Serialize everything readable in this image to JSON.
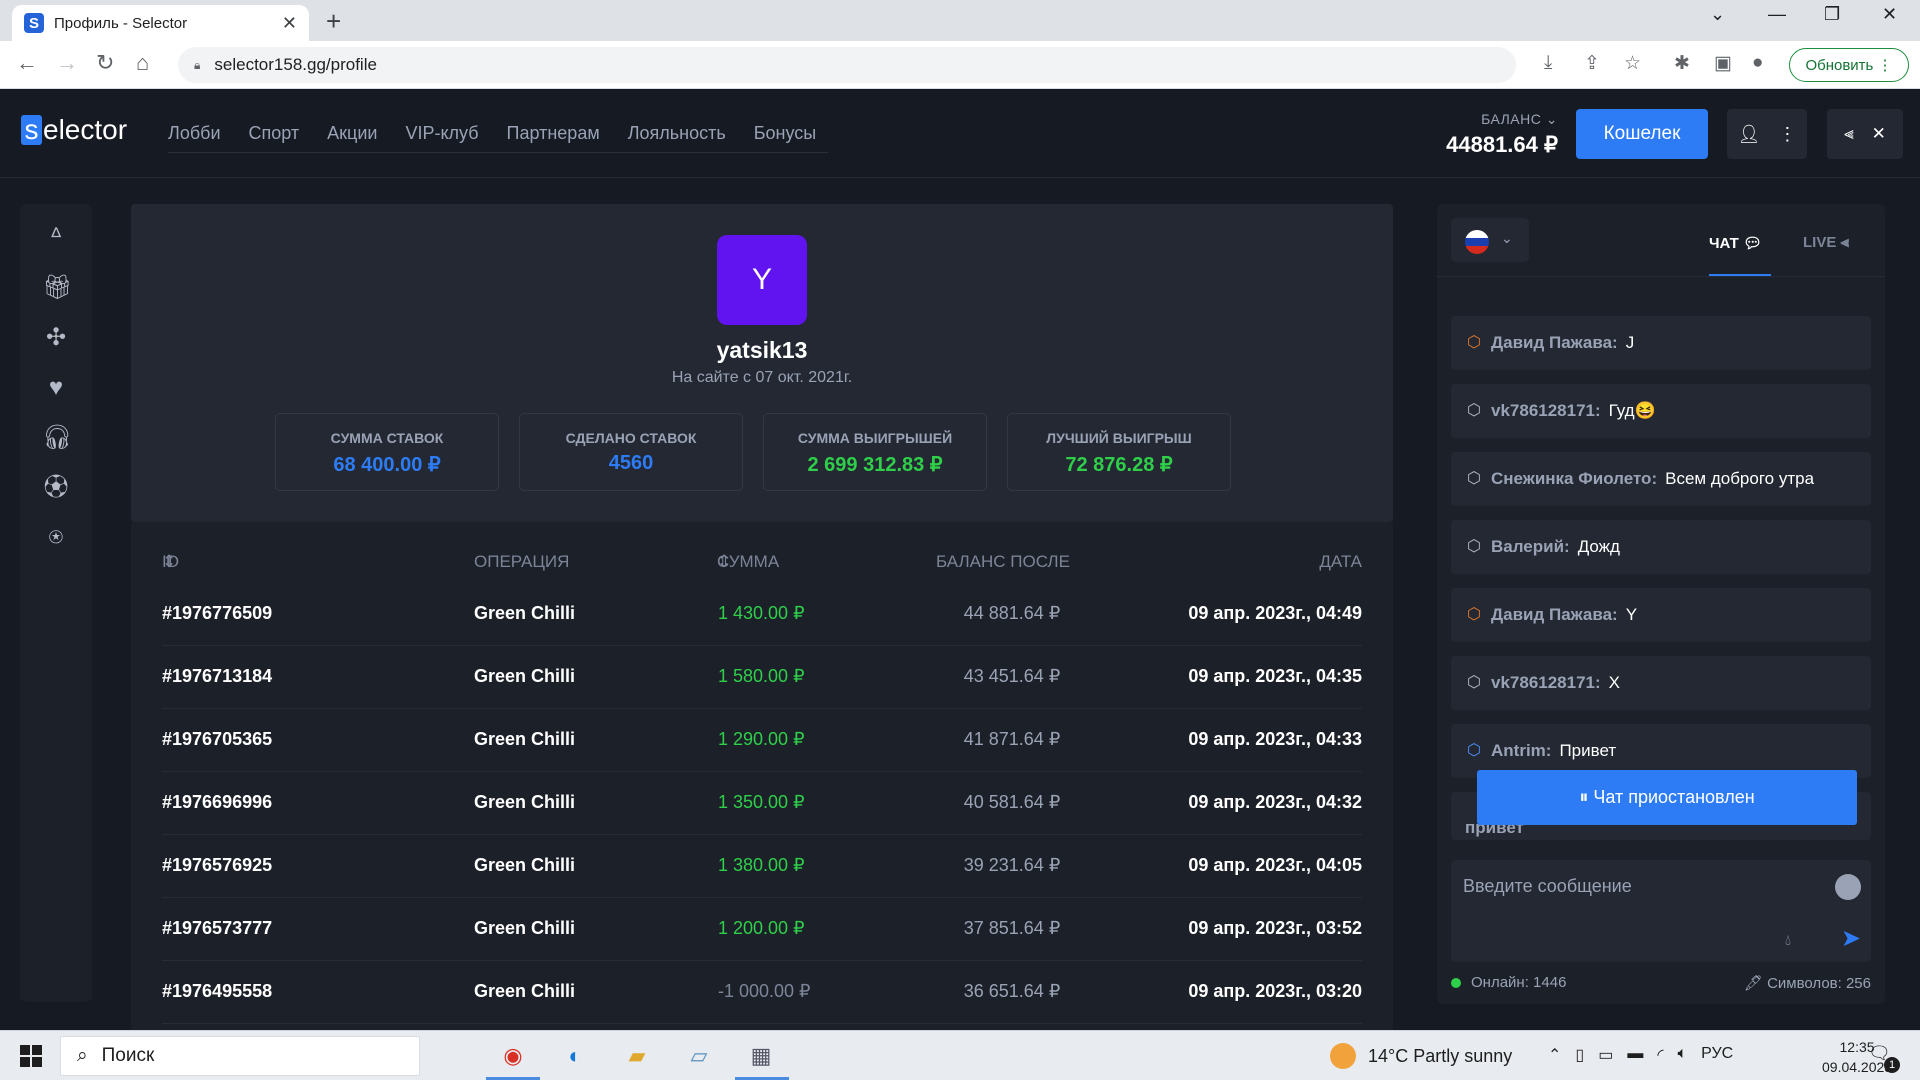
{
  "browser": {
    "tab_title": "Профиль - Selector",
    "tab_favicon": "S",
    "url": "selector158.gg/profile",
    "update_label": "Обновить"
  },
  "site": {
    "logo_first": "s",
    "logo_rest": "elector",
    "nav": [
      "Лобби",
      "Спорт",
      "Акции",
      "VIP-клуб",
      "Партнерам",
      "Лояльность",
      "Бонусы"
    ],
    "balance_label": "БАЛАНС",
    "balance_value": "44881.64 ₽",
    "wallet_label": "Кошелек",
    "accent": "#2d7cf6"
  },
  "sidebar_icons": [
    "cherries-icon",
    "gift-icon",
    "fan-icon",
    "heart-icon",
    "headset-icon",
    "soccer-ball-icon",
    "speed-icon"
  ],
  "profile": {
    "avatar_letter": "Y",
    "avatar_color": "#6214f0",
    "username": "yatsik13",
    "since": "На сайте с 07 окт. 2021г.",
    "stats": [
      {
        "label": "СУММА СТАВОК",
        "value": "68 400.00 ₽",
        "color": "blue"
      },
      {
        "label": "СДЕЛАНО СТАВОК",
        "value": "4560",
        "color": "blue"
      },
      {
        "label": "СУММА ВЫИГРЫШЕЙ",
        "value": "2 699 312.83 ₽",
        "color": "green"
      },
      {
        "label": "ЛУЧШИЙ ВЫИГРЫШ",
        "value": "72 876.28 ₽",
        "color": "green"
      }
    ]
  },
  "table": {
    "headers": {
      "id": "ID",
      "operation": "ОПЕРАЦИЯ",
      "sum": "СУММА",
      "balance": "БАЛАНС ПОСЛЕ",
      "date": "ДАТА"
    },
    "rows": [
      {
        "id": "#1976776509",
        "op": "Green Chilli",
        "sum": "1 430.00 ₽",
        "balance": "44 881.64 ₽",
        "date": "09 апр. 2023г., 04:49",
        "positive": true
      },
      {
        "id": "#1976713184",
        "op": "Green Chilli",
        "sum": "1 580.00 ₽",
        "balance": "43 451.64 ₽",
        "date": "09 апр. 2023г., 04:35",
        "positive": true
      },
      {
        "id": "#1976705365",
        "op": "Green Chilli",
        "sum": "1 290.00 ₽",
        "balance": "41 871.64 ₽",
        "date": "09 апр. 2023г., 04:33",
        "positive": true
      },
      {
        "id": "#1976696996",
        "op": "Green Chilli",
        "sum": "1 350.00 ₽",
        "balance": "40 581.64 ₽",
        "date": "09 апр. 2023г., 04:32",
        "positive": true
      },
      {
        "id": "#1976576925",
        "op": "Green Chilli",
        "sum": "1 380.00 ₽",
        "balance": "39 231.64 ₽",
        "date": "09 апр. 2023г., 04:05",
        "positive": true
      },
      {
        "id": "#1976573777",
        "op": "Green Chilli",
        "sum": "1 200.00 ₽",
        "balance": "37 851.64 ₽",
        "date": "09 апр. 2023г., 03:52",
        "positive": true
      },
      {
        "id": "#1976495558",
        "op": "Green Chilli",
        "sum": "-1 000.00 ₽",
        "balance": "36 651.64 ₽",
        "date": "09 апр. 2023г., 03:20",
        "positive": false
      }
    ]
  },
  "chat": {
    "tab_chat": "ЧАТ",
    "tab_live": "LIVE",
    "messages": [
      {
        "author": "Давид Пажава:",
        "text": "J",
        "rank": "bronze"
      },
      {
        "author": "vk786128171:",
        "text": "Гуд😆",
        "rank": "none"
      },
      {
        "author": "Снежинка Фиолето:",
        "text": "Всем доброго утра",
        "rank": "none"
      },
      {
        "author": "Валерий:",
        "text": "Дожд",
        "rank": "none"
      },
      {
        "author": "Давид Пажава:",
        "text": "Y",
        "rank": "bronze"
      },
      {
        "author": "vk786128171:",
        "text": "X",
        "rank": "none"
      },
      {
        "author": "Antrim:",
        "text": "Привет",
        "rank": "blue"
      }
    ],
    "partial_message": "привет",
    "paused_label": "Чат приостановлен",
    "input_placeholder": "Введите сообщение",
    "online_label": "Онлайн: 1446",
    "chars_label": "Символов: 256"
  },
  "taskbar": {
    "search_label": "Поиск",
    "weather": "14°C  Partly sunny",
    "lang": "РУС",
    "time": "12:35",
    "date": "09.04.2023",
    "notifications": "1"
  }
}
